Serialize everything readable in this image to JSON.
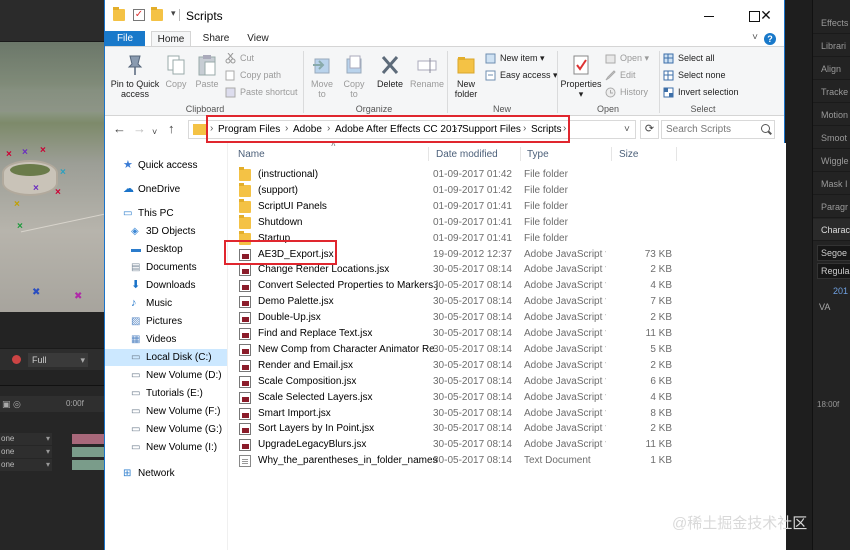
{
  "window": {
    "title": "Scripts",
    "controls": {
      "minimize": "",
      "maximize": "",
      "close": "✕"
    }
  },
  "ribbon": {
    "tabs": [
      "File",
      "Home",
      "Share",
      "View"
    ],
    "clipboard": {
      "label": "Clipboard",
      "pin": "Pin to Quick access",
      "copy": "Copy",
      "paste": "Paste",
      "cut": "Cut",
      "copy_path": "Copy path",
      "paste_shortcut": "Paste shortcut"
    },
    "organize": {
      "label": "Organize",
      "move_to": "Move to",
      "copy_to": "Copy to",
      "delete": "Delete",
      "rename": "Rename"
    },
    "new": {
      "label": "New",
      "new_folder": "New folder",
      "new_item": "New item",
      "easy_access": "Easy access"
    },
    "open": {
      "label": "Open",
      "properties": "Properties",
      "open": "Open",
      "edit": "Edit",
      "history": "History"
    },
    "select": {
      "label": "Select",
      "select_all": "Select all",
      "select_none": "Select none",
      "invert": "Invert selection"
    }
  },
  "address": {
    "crumbs": [
      "Program Files",
      "Adobe",
      "Adobe After Effects CC 2017",
      "Support Files",
      "Scripts"
    ],
    "search_placeholder": "Search Scripts"
  },
  "nav": {
    "items": [
      {
        "label": "Quick access",
        "icon": "star-icon"
      },
      {
        "label": "OneDrive",
        "icon": "cloud-icon"
      },
      {
        "label": "This PC",
        "icon": "pc-icon"
      },
      {
        "label": "3D Objects",
        "icon": "cube-icon"
      },
      {
        "label": "Desktop",
        "icon": "desktop-icon"
      },
      {
        "label": "Documents",
        "icon": "documents-icon"
      },
      {
        "label": "Downloads",
        "icon": "download-icon"
      },
      {
        "label": "Music",
        "icon": "music-icon"
      },
      {
        "label": "Pictures",
        "icon": "pictures-icon"
      },
      {
        "label": "Videos",
        "icon": "videos-icon"
      },
      {
        "label": "Local Disk (C:)",
        "icon": "drive-icon"
      },
      {
        "label": "New Volume (D:)",
        "icon": "drive-icon"
      },
      {
        "label": "Tutorials (E:)",
        "icon": "drive-icon"
      },
      {
        "label": "New Volume (F:)",
        "icon": "drive-icon"
      },
      {
        "label": "New Volume (G:)",
        "icon": "drive-icon"
      },
      {
        "label": "New Volume (I:)",
        "icon": "drive-icon"
      },
      {
        "label": "Network",
        "icon": "network-icon"
      }
    ]
  },
  "files": {
    "columns": [
      "Name",
      "Date modified",
      "Type",
      "Size"
    ],
    "rows": [
      {
        "name": "(instructional)",
        "date": "01-09-2017 01:42",
        "type": "File folder",
        "size": "",
        "kind": "folder"
      },
      {
        "name": "(support)",
        "date": "01-09-2017 01:42",
        "type": "File folder",
        "size": "",
        "kind": "folder"
      },
      {
        "name": "ScriptUI Panels",
        "date": "01-09-2017 01:41",
        "type": "File folder",
        "size": "",
        "kind": "folder"
      },
      {
        "name": "Shutdown",
        "date": "01-09-2017 01:41",
        "type": "File folder",
        "size": "",
        "kind": "folder"
      },
      {
        "name": "Startup",
        "date": "01-09-2017 01:41",
        "type": "File folder",
        "size": "",
        "kind": "folder"
      },
      {
        "name": "AE3D_Export.jsx",
        "date": "19-09-2012 12:37",
        "type": "Adobe JavaScript f...",
        "size": "73 KB",
        "kind": "js"
      },
      {
        "name": "Change Render Locations.jsx",
        "date": "30-05-2017 08:14",
        "type": "Adobe JavaScript f...",
        "size": "2 KB",
        "kind": "js"
      },
      {
        "name": "Convert Selected Properties to Markers.jsx",
        "date": "30-05-2017 08:14",
        "type": "Adobe JavaScript f...",
        "size": "4 KB",
        "kind": "js"
      },
      {
        "name": "Demo Palette.jsx",
        "date": "30-05-2017 08:14",
        "type": "Adobe JavaScript f...",
        "size": "7 KB",
        "kind": "js"
      },
      {
        "name": "Double-Up.jsx",
        "date": "30-05-2017 08:14",
        "type": "Adobe JavaScript f...",
        "size": "2 KB",
        "kind": "js"
      },
      {
        "name": "Find and Replace Text.jsx",
        "date": "30-05-2017 08:14",
        "type": "Adobe JavaScript f...",
        "size": "11 KB",
        "kind": "js"
      },
      {
        "name": "New Comp from Character Animator Re...",
        "date": "30-05-2017 08:14",
        "type": "Adobe JavaScript f...",
        "size": "5 KB",
        "kind": "js"
      },
      {
        "name": "Render and Email.jsx",
        "date": "30-05-2017 08:14",
        "type": "Adobe JavaScript f...",
        "size": "2 KB",
        "kind": "js"
      },
      {
        "name": "Scale Composition.jsx",
        "date": "30-05-2017 08:14",
        "type": "Adobe JavaScript f...",
        "size": "6 KB",
        "kind": "js"
      },
      {
        "name": "Scale Selected Layers.jsx",
        "date": "30-05-2017 08:14",
        "type": "Adobe JavaScript f...",
        "size": "4 KB",
        "kind": "js"
      },
      {
        "name": "Smart Import.jsx",
        "date": "30-05-2017 08:14",
        "type": "Adobe JavaScript f...",
        "size": "8 KB",
        "kind": "js"
      },
      {
        "name": "Sort Layers by In Point.jsx",
        "date": "30-05-2017 08:14",
        "type": "Adobe JavaScript f...",
        "size": "2 KB",
        "kind": "js"
      },
      {
        "name": "UpgradeLegacyBlurs.jsx",
        "date": "30-05-2017 08:14",
        "type": "Adobe JavaScript f...",
        "size": "11 KB",
        "kind": "js"
      },
      {
        "name": "Why_the_parentheses_in_folder_names.txt",
        "date": "30-05-2017 08:14",
        "type": "Text Document",
        "size": "1 KB",
        "kind": "txt"
      }
    ]
  },
  "ae": {
    "viewer_quality": "Full",
    "right_panels": [
      "Effects",
      "Librari",
      "Align",
      "Tracke",
      "Motion",
      "Smoot",
      "Wiggle",
      "Mask I",
      "Paragr",
      "Charac"
    ],
    "font_field": "Segoe",
    "style_field": "Regula",
    "value": "201",
    "timeline_rows": [
      "one",
      "one",
      "one"
    ],
    "timecode": "18:00f",
    "timecode_small": "0:00f"
  },
  "watermark": "@稀土掘金技术社区",
  "colors": {
    "accent": "#1979ca",
    "highlight_red": "#e0262e",
    "selection": "#cce8ff"
  }
}
